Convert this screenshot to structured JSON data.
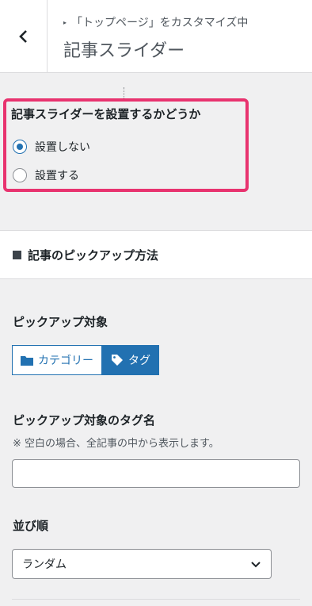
{
  "header": {
    "back_label": "戻る",
    "breadcrumb": "「トップページ」をカスタマイズ中",
    "title": "記事スライダー"
  },
  "slider_setting": {
    "heading": "記事スライダーを設置するかどうか",
    "options": [
      {
        "label": "設置しない",
        "checked": true
      },
      {
        "label": "設置する",
        "checked": false
      }
    ]
  },
  "pickup": {
    "section_title": "記事のピックアップ方法",
    "target_label": "ピックアップ対象",
    "target_buttons": [
      {
        "label": "カテゴリー",
        "icon": "folder-icon",
        "selected": false
      },
      {
        "label": "タグ",
        "icon": "tag-icon",
        "selected": true
      }
    ],
    "tag_name_label": "ピックアップ対象のタグ名",
    "tag_name_note": "※ 空白の場合、全記事の中から表示します。",
    "tag_name_value": "",
    "order_label": "並び順",
    "order_value": "ランダム"
  },
  "colors": {
    "accent": "#2271b1",
    "highlight": "#e8336f"
  }
}
